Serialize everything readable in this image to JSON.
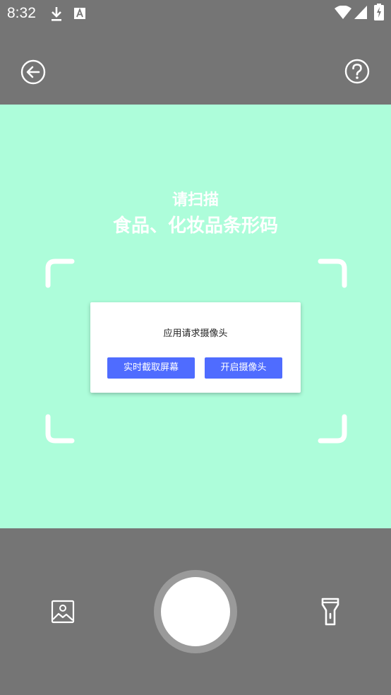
{
  "status_bar": {
    "time": "8:32",
    "left_icons": [
      "download-icon",
      "font-a-icon"
    ],
    "right_icons": [
      "wifi-icon",
      "signal-icon",
      "battery-charging-icon"
    ]
  },
  "top_bar": {
    "back_icon": "back-arrow-circle-icon",
    "help_icon": "help-circle-icon"
  },
  "scan": {
    "prompt_line1": "请扫描",
    "prompt_line2": "食品、化妆品条形码",
    "background_color": "#adfdda"
  },
  "dialog": {
    "message": "应用请求摄像头",
    "button_screenshot": "实时截取屏幕",
    "button_camera": "开启摄像头",
    "button_color": "#4f6cff"
  },
  "bottom_bar": {
    "gallery_icon": "gallery-image-icon",
    "shutter": "shutter-button",
    "flashlight_icon": "flashlight-icon"
  },
  "colors": {
    "chrome": "#757575",
    "accent": "#4f6cff"
  }
}
